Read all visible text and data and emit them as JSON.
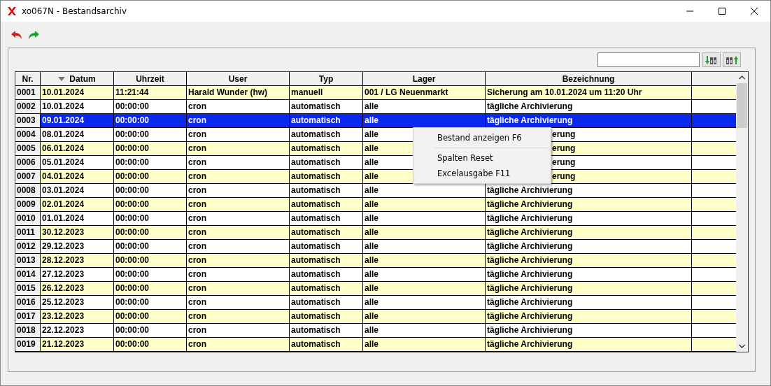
{
  "window": {
    "title": "xo067N - Bestandsarchiv"
  },
  "table": {
    "columns": [
      {
        "label": "Nr.",
        "sorted": false
      },
      {
        "label": "Datum",
        "sorted": true
      },
      {
        "label": "Uhrzeit",
        "sorted": false
      },
      {
        "label": "User",
        "sorted": false
      },
      {
        "label": "Typ",
        "sorted": false
      },
      {
        "label": "Lager",
        "sorted": false
      },
      {
        "label": "Bezeichnung",
        "sorted": false
      }
    ],
    "rows": [
      {
        "cells": [
          "0001",
          "10.01.2024",
          "11:21:44",
          "Harald Wunder (hw)",
          "manuell",
          "001 / LG Neuenmarkt",
          "Sicherung am 10.01.2024 um 11:20 Uhr"
        ],
        "selected": false
      },
      {
        "cells": [
          "0002",
          "10.01.2024",
          "00:00:00",
          "cron",
          "automatisch",
          "alle",
          "tägliche Archivierung"
        ],
        "selected": false
      },
      {
        "cells": [
          "0003",
          "09.01.2024",
          "00:00:00",
          "cron",
          "automatisch",
          "alle",
          "tägliche Archivierung"
        ],
        "selected": true
      },
      {
        "cells": [
          "0004",
          "08.01.2024",
          "00:00:00",
          "cron",
          "automatisch",
          "alle",
          "erung"
        ],
        "selected": false,
        "under_menu": true
      },
      {
        "cells": [
          "0005",
          "06.01.2024",
          "00:00:00",
          "cron",
          "automatisch",
          "alle",
          "erung"
        ],
        "selected": false,
        "under_menu": true
      },
      {
        "cells": [
          "0006",
          "05.01.2024",
          "00:00:00",
          "cron",
          "automatisch",
          "alle",
          "erung"
        ],
        "selected": false,
        "under_menu": true
      },
      {
        "cells": [
          "0007",
          "04.01.2024",
          "00:00:00",
          "cron",
          "automatisch",
          "alle",
          "erung"
        ],
        "selected": false,
        "under_menu": true
      },
      {
        "cells": [
          "0008",
          "03.01.2024",
          "00:00:00",
          "cron",
          "automatisch",
          "alle",
          "tägliche Archivierung"
        ],
        "selected": false
      },
      {
        "cells": [
          "0009",
          "02.01.2024",
          "00:00:00",
          "cron",
          "automatisch",
          "alle",
          "tägliche Archivierung"
        ],
        "selected": false
      },
      {
        "cells": [
          "0010",
          "01.01.2024",
          "00:00:00",
          "cron",
          "automatisch",
          "alle",
          "tägliche Archivierung"
        ],
        "selected": false
      },
      {
        "cells": [
          "0011",
          "30.12.2023",
          "00:00:00",
          "cron",
          "automatisch",
          "alle",
          "tägliche Archivierung"
        ],
        "selected": false
      },
      {
        "cells": [
          "0012",
          "29.12.2023",
          "00:00:00",
          "cron",
          "automatisch",
          "alle",
          "tägliche Archivierung"
        ],
        "selected": false
      },
      {
        "cells": [
          "0013",
          "28.12.2023",
          "00:00:00",
          "cron",
          "automatisch",
          "alle",
          "tägliche Archivierung"
        ],
        "selected": false
      },
      {
        "cells": [
          "0014",
          "27.12.2023",
          "00:00:00",
          "cron",
          "automatisch",
          "alle",
          "tägliche Archivierung"
        ],
        "selected": false
      },
      {
        "cells": [
          "0015",
          "26.12.2023",
          "00:00:00",
          "cron",
          "automatisch",
          "alle",
          "tägliche Archivierung"
        ],
        "selected": false
      },
      {
        "cells": [
          "0016",
          "25.12.2023",
          "00:00:00",
          "cron",
          "automatisch",
          "alle",
          "tägliche Archivierung"
        ],
        "selected": false
      },
      {
        "cells": [
          "0017",
          "23.12.2023",
          "00:00:00",
          "cron",
          "automatisch",
          "alle",
          "tägliche Archivierung"
        ],
        "selected": false
      },
      {
        "cells": [
          "0018",
          "22.12.2023",
          "00:00:00",
          "cron",
          "automatisch",
          "alle",
          "tägliche Archivierung"
        ],
        "selected": false
      },
      {
        "cells": [
          "0019",
          "21.12.2023",
          "00:00:00",
          "cron",
          "automatisch",
          "alle",
          "tägliche Archivierung"
        ],
        "selected": false
      }
    ]
  },
  "context_menu": {
    "items": [
      {
        "label": "Bestand anzeigen F6",
        "kind": "item"
      },
      {
        "kind": "separator"
      },
      {
        "label": "Spalten Reset",
        "kind": "item"
      },
      {
        "label": "Excelausgabe F11",
        "kind": "item"
      }
    ]
  }
}
